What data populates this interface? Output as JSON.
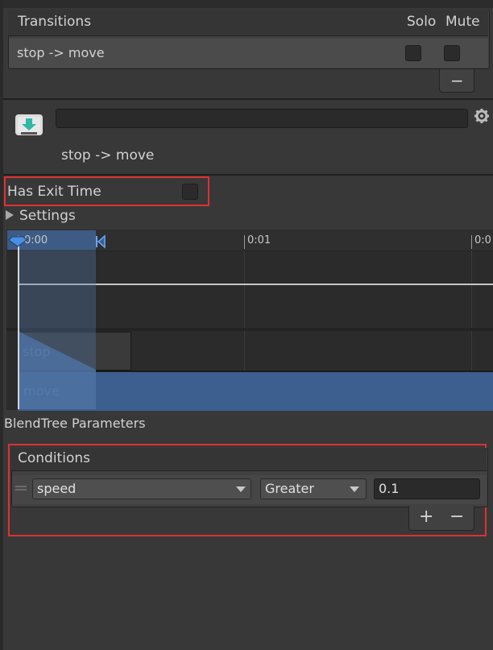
{
  "transitions": {
    "title": "Transitions",
    "solo_label": "Solo",
    "mute_label": "Mute",
    "rows": [
      {
        "label": "stop -> move"
      }
    ],
    "remove_label": "−"
  },
  "transition": {
    "name_value": "",
    "subtitle": "stop -> move",
    "icon": "transition-icon",
    "settings_icon": "gear-icon"
  },
  "options": {
    "has_exit_time_label": "Has Exit Time",
    "has_exit_time_checked": false,
    "settings_label": "Settings"
  },
  "timeline": {
    "ticks": [
      "0:00",
      "0:01",
      "0:0"
    ],
    "source_state": "stop",
    "destination_state": "move",
    "colors": {
      "selection": "#3c5f8f"
    }
  },
  "blendtree_label": "BlendTree Parameters",
  "conditions": {
    "title": "Conditions",
    "items": [
      {
        "parameter": "speed",
        "operator": "Greater",
        "value": "0.1"
      }
    ],
    "add_label": "+",
    "remove_label": "−"
  },
  "highlight_color": "#e03030"
}
